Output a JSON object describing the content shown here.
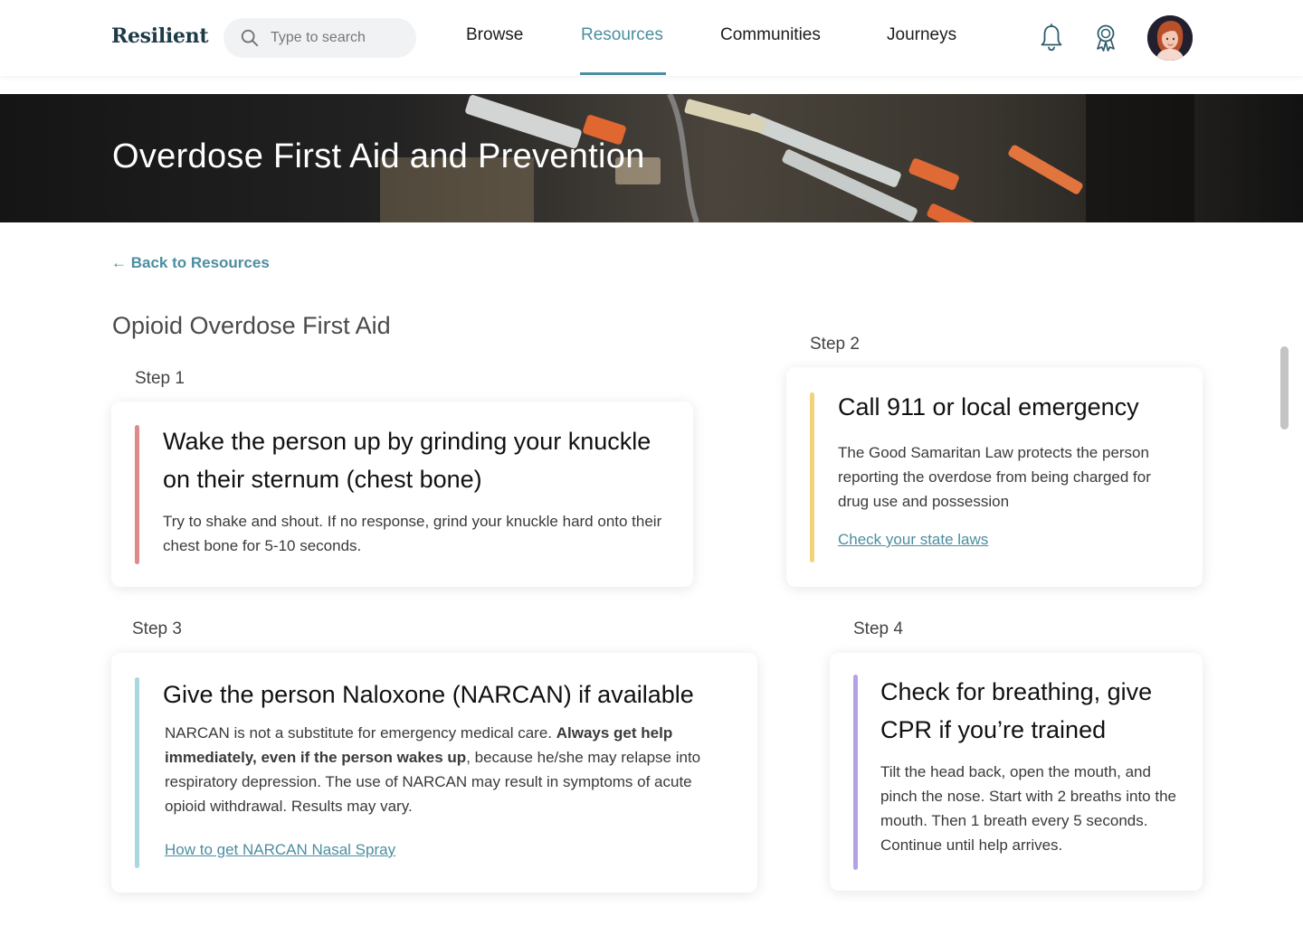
{
  "header": {
    "logo": "Resilient",
    "search_placeholder": "Type to search",
    "nav": [
      {
        "label": "Browse"
      },
      {
        "label": "Resources",
        "active": true
      },
      {
        "label": "Communities"
      },
      {
        "label": "Journeys"
      }
    ],
    "icons": [
      "search-icon",
      "bell-icon",
      "award-ribbon-icon",
      "user-avatar"
    ]
  },
  "hero": {
    "title": "Overdose First Aid and Prevention"
  },
  "back_link": "← Back to Resources",
  "section_title": "Opioid Overdose First Aid",
  "steps": [
    {
      "label": "Step 1",
      "title": "Wake the person up by grinding your knuckle on their sternum (chest bone)",
      "body": "Try to shake and shout. If no response, grind your knuckle hard onto their chest bone for 5-10 seconds.",
      "accent": "#e08a8e"
    },
    {
      "label": "Step 2",
      "title": "Call 911 or local emergency",
      "body": "The Good Samaritan Law protects the person reporting the overdose from being charged for drug use and possession",
      "link": "Check your state laws",
      "accent": "#f2d27a"
    },
    {
      "label": "Step 3",
      "title": "Give the person Naloxone (NARCAN) if available",
      "body_prefix": "NARCAN is not a substitute for emergency medical care. ",
      "body_bold": "Always get help immediately, even if the person wakes up",
      "body_suffix": ", because he/she may relapse into respiratory depression. The use of NARCAN may result in symptoms of acute opioid withdrawal. Results may vary.",
      "link": "How to get NARCAN Nasal Spray",
      "accent": "#a6d9e0"
    },
    {
      "label": "Step 4",
      "title": "Check for breathing, give CPR if you’re trained",
      "body": "Tilt the head back, open the mouth, and pinch the nose. Start with 2 breaths into the mouth. Then 1 breath every 5 seconds. Continue until help arrives.",
      "accent": "#b3a3e6"
    }
  ],
  "colors": {
    "brand": "#1f3a48",
    "accent_link": "#4c8ea0"
  }
}
